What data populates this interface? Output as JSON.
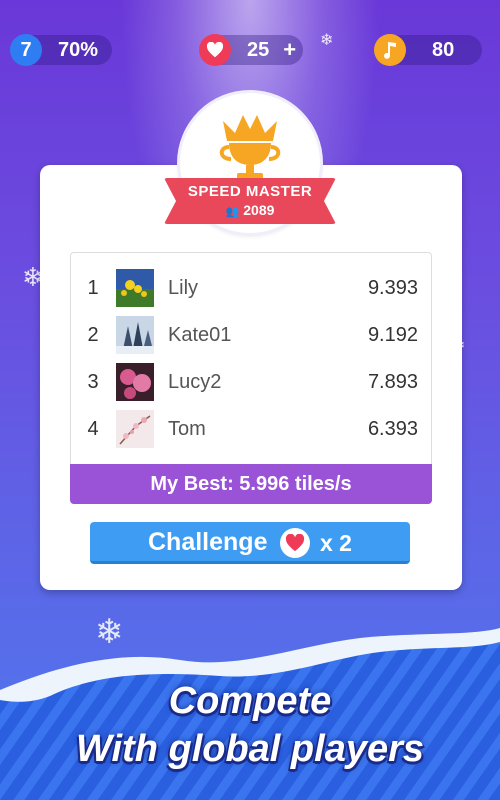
{
  "status_bar": {
    "level": "7",
    "progress": "70%",
    "lives": "25",
    "lives_add": "+",
    "coins": "80"
  },
  "badge": {
    "title": "SPEED MASTER",
    "players": "2089"
  },
  "leaderboard": [
    {
      "rank": "1",
      "name": "Lily",
      "score": "9.393",
      "thumb": "yellow-flowers-photo"
    },
    {
      "rank": "2",
      "name": "Kate01",
      "score": "9.192",
      "thumb": "winter-forest-photo"
    },
    {
      "rank": "3",
      "name": "Lucy2",
      "score": "7.893",
      "thumb": "pink-flowers-photo"
    },
    {
      "rank": "4",
      "name": "Tom",
      "score": "6.393",
      "thumb": "cherry-blossom-photo"
    }
  ],
  "my_best": "My Best: 5.996 tiles/s",
  "challenge": {
    "label": "Challenge",
    "multiplier": "x 2"
  },
  "caption": {
    "line1": "Compete",
    "line2": "With global players"
  },
  "colors": {
    "accent_purple": "#9a52d6",
    "button_blue": "#3e9df3",
    "heart_red": "#ef3b58",
    "coin_gold": "#f6a623",
    "ribbon_red": "#e8485a"
  }
}
